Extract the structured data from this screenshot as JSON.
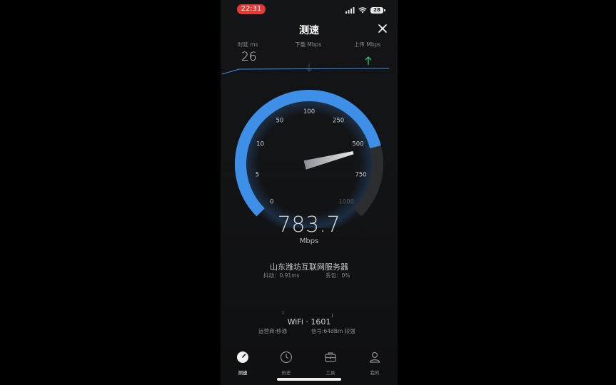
{
  "status_bar": {
    "time": "22:31",
    "battery": "28"
  },
  "header": {
    "title": "测速"
  },
  "metrics": {
    "latency": {
      "label": "时延 ms",
      "value": "26"
    },
    "download": {
      "label": "下载 Mbps"
    },
    "upload": {
      "label": "上传 Mbps"
    }
  },
  "gauge": {
    "ticks": [
      "0",
      "5",
      "10",
      "50",
      "100",
      "250",
      "500",
      "750",
      "1000"
    ],
    "current_speed": "783.7",
    "unit": "Mbps",
    "fill_fraction": 0.78
  },
  "server": {
    "name": "山东潍坊互联网服务器",
    "jitter": "抖动：0.91ms",
    "packet_loss": "丢包：0%"
  },
  "network": {
    "name": "WiFi · 1601",
    "carrier": "运营商:移通",
    "signal": "信号:64dBm 较强"
  },
  "tabs": [
    {
      "label": "测速"
    },
    {
      "label": "历史"
    },
    {
      "label": "工具"
    },
    {
      "label": "我的"
    }
  ],
  "colors": {
    "accent": "#3d8fe8",
    "upload_arrow": "#2ecc71",
    "time_pill": "#e53935"
  }
}
